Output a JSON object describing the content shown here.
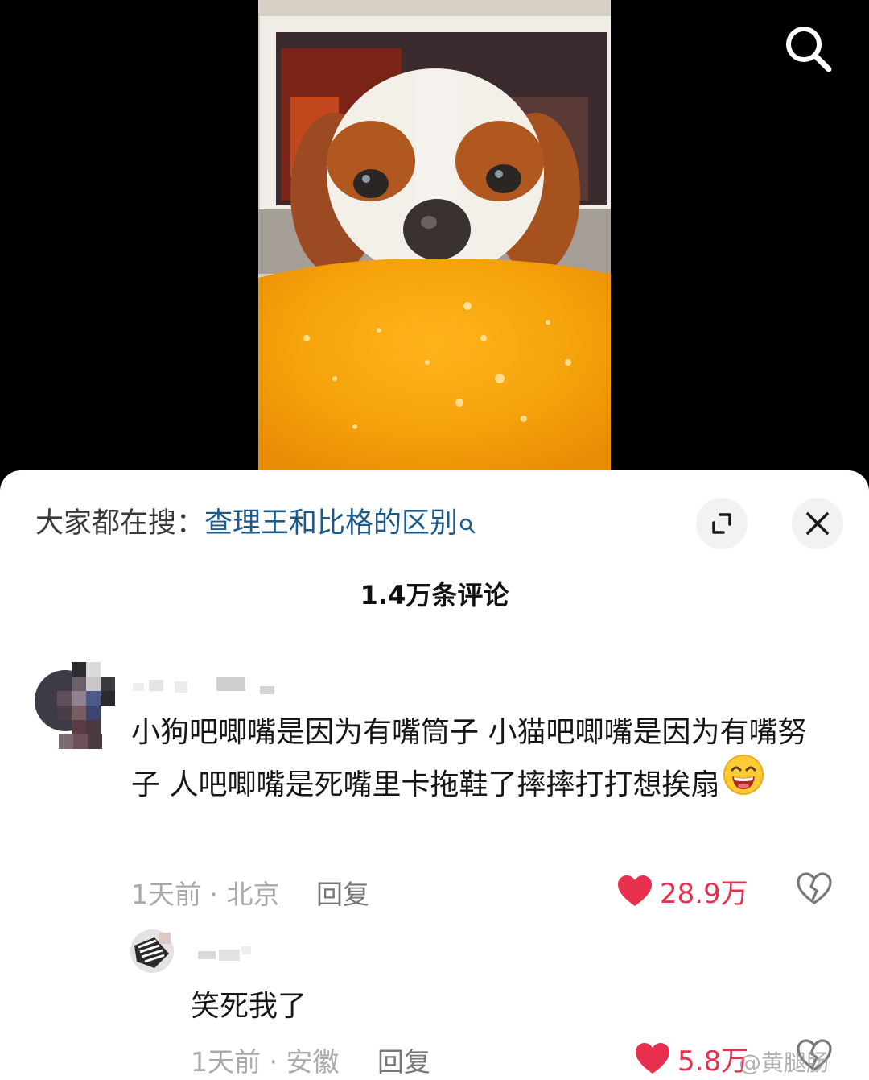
{
  "hot_search": {
    "prefix": "大家都在搜：",
    "term": "查理王和比格的区别"
  },
  "comments_title": "1.4万条评论",
  "comment": {
    "text": "小狗吧唧嘴是因为有嘴筒子 小猫吧唧嘴是因为有嘴努子 人吧唧嘴是死嘴里卡拖鞋了摔摔打打想挨扇",
    "time_location": "1天前 · 北京",
    "reply_label": "回复",
    "likes": "28.9万"
  },
  "reply": {
    "text": "笑死我了",
    "time_location": "1天前 · 安徽",
    "reply_label": "回复",
    "likes": "5.8万"
  },
  "watermark": "@黄腿肠",
  "colors": {
    "link_blue": "#1d5a8c",
    "like_red": "#e8304e",
    "meta_gray": "#a9a9a9",
    "sheet_bg": "#ffffff",
    "video_bg": "#000000"
  },
  "icons": [
    "search-icon",
    "expand-icon",
    "close-icon",
    "heart-icon",
    "broken-heart-icon",
    "grin-emoji-icon"
  ]
}
